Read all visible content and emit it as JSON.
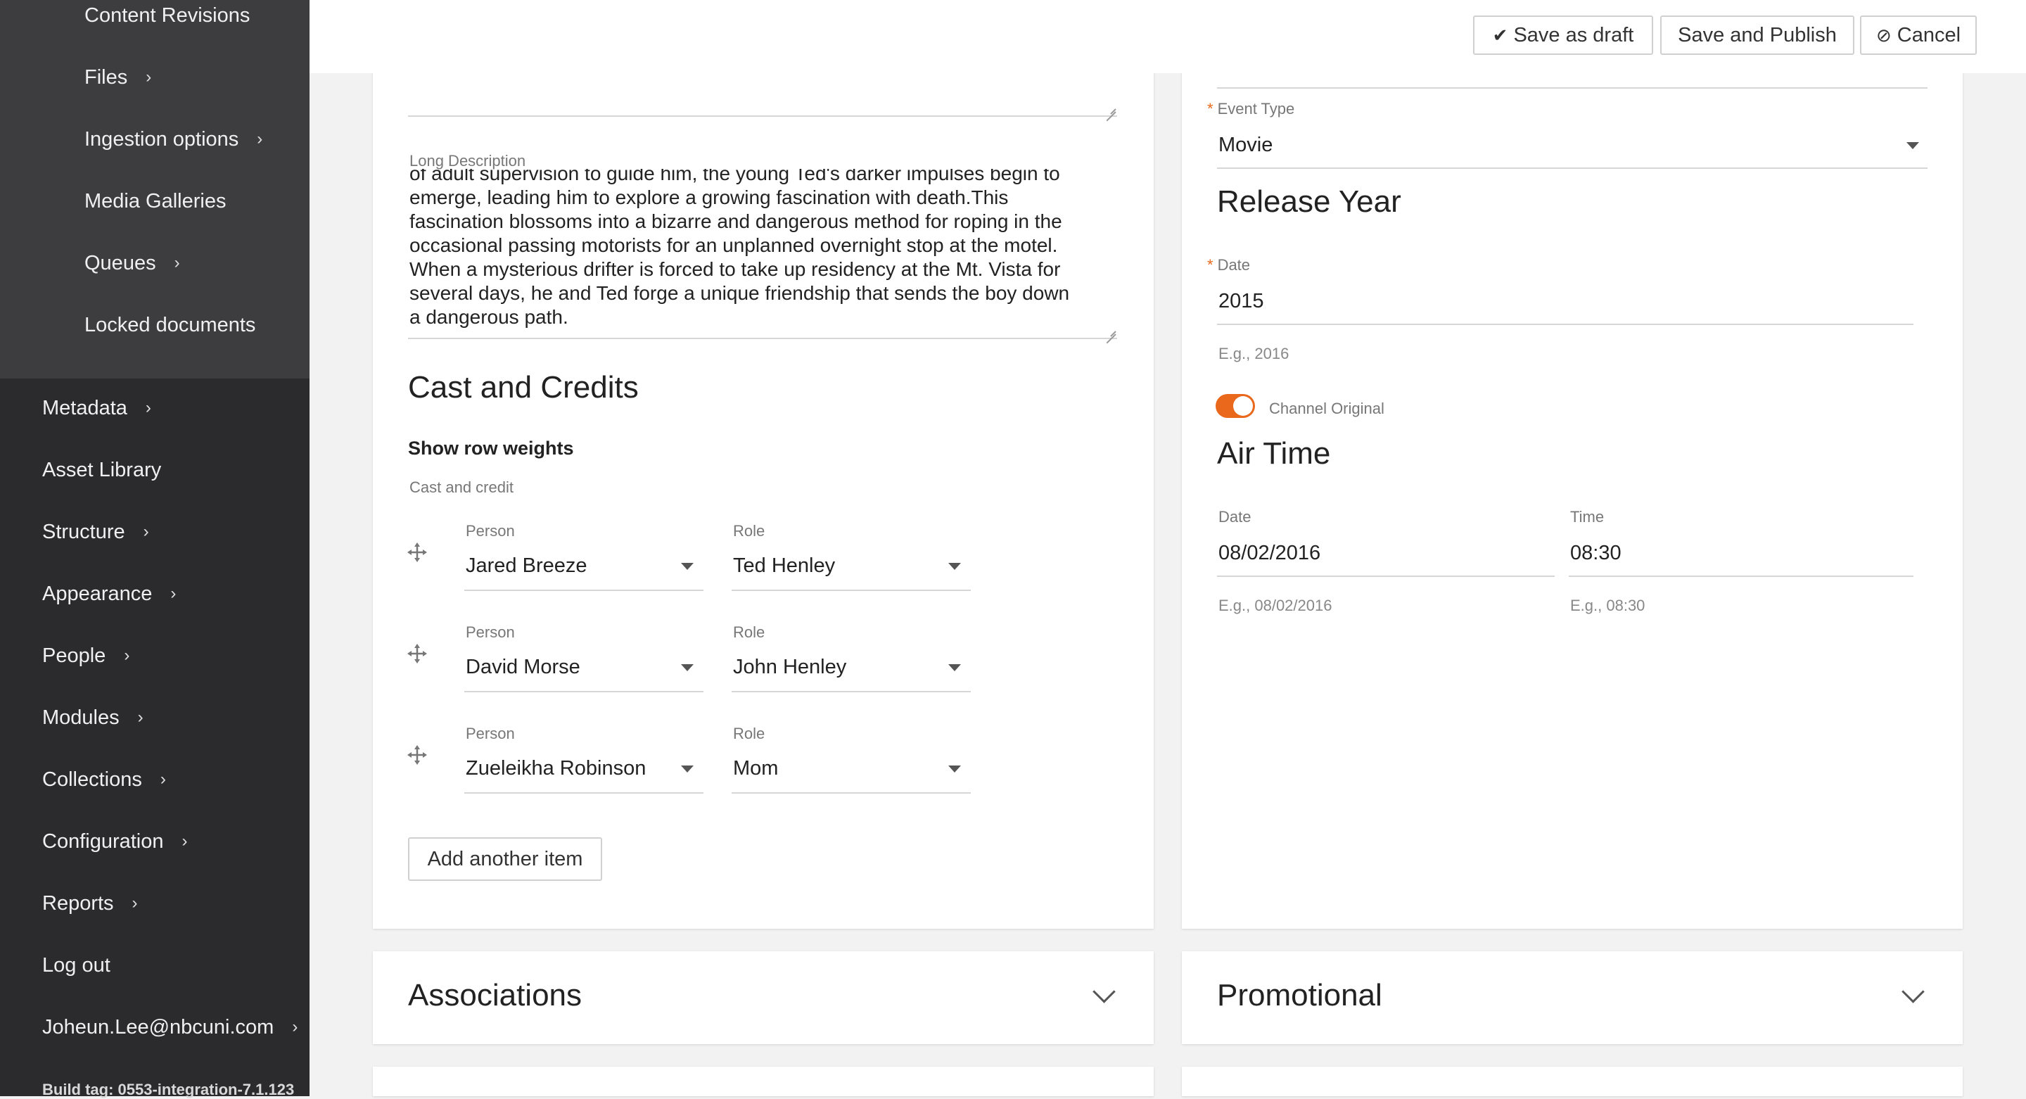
{
  "sidebar": {
    "sub_items": [
      {
        "label": "Content Revisions",
        "chevron": false
      },
      {
        "label": "Files",
        "chevron": true
      },
      {
        "label": "Ingestion options",
        "chevron": true
      },
      {
        "label": "Media Galleries",
        "chevron": false
      },
      {
        "label": "Queues",
        "chevron": true
      },
      {
        "label": "Locked documents",
        "chevron": false
      }
    ],
    "main_items": [
      {
        "label": "Metadata",
        "chevron": true
      },
      {
        "label": "Asset Library",
        "chevron": false
      },
      {
        "label": "Structure",
        "chevron": true
      },
      {
        "label": "Appearance",
        "chevron": true
      },
      {
        "label": "People",
        "chevron": true
      },
      {
        "label": "Modules",
        "chevron": true
      },
      {
        "label": "Collections",
        "chevron": true
      },
      {
        "label": "Configuration",
        "chevron": true
      },
      {
        "label": "Reports",
        "chevron": true
      },
      {
        "label": "Log out",
        "chevron": false
      },
      {
        "label": "Joheun.Lee@nbcuni.com",
        "chevron": true
      }
    ],
    "build_tag": "Build tag: 0553-integration-7.1.123"
  },
  "toolbar": {
    "save_draft": "Save as draft",
    "save_publish": "Save and Publish",
    "cancel": "Cancel"
  },
  "left_panel": {
    "long_description_label": "Long Description",
    "long_description_lines": [
      "of adult supervision to guide him, the young Ted's darker impulses begin to",
      "emerge, leading him to explore a growing fascination with death.This",
      "fascination blossoms into a bizarre and dangerous method for roping in the",
      "occasional passing motorists for an unplanned overnight stop at the motel.",
      "When a mysterious drifter is forced to take up residency at the Mt. Vista for",
      "several days, he and Ted forge a unique friendship that sends the boy down",
      "a dangerous path."
    ],
    "cast_heading": "Cast and Credits",
    "show_row_weights": "Show row weights",
    "cast_label": "Cast and credit",
    "person_label": "Person",
    "role_label": "Role",
    "rows": [
      {
        "person": "Jared Breeze",
        "role": "Ted Henley"
      },
      {
        "person": "David Morse",
        "role": "John Henley"
      },
      {
        "person": "Zueleikha Robinson",
        "role": "Mom"
      }
    ],
    "add_item": "Add another item"
  },
  "right_panel": {
    "event_type_label": "Event Type",
    "event_type_value": "Movie",
    "release_year_heading": "Release Year",
    "date_label": "Date",
    "date_value": "2015",
    "date_hint": "E.g., 2016",
    "channel_original_label": "Channel Original",
    "channel_original_on": true,
    "air_time_heading": "Air Time",
    "air_date_label": "Date",
    "air_date_value": "08/02/2016",
    "air_date_hint": "E.g., 08/02/2016",
    "air_time_label": "Time",
    "air_time_value": "08:30",
    "air_time_hint": "E.g., 08:30"
  },
  "sections": {
    "associations": "Associations",
    "promotional": "Promotional"
  },
  "colors": {
    "sidebar_bg": "#2b2b2d",
    "submenu_bg": "#3d3d40",
    "accent": "#e9681c"
  }
}
